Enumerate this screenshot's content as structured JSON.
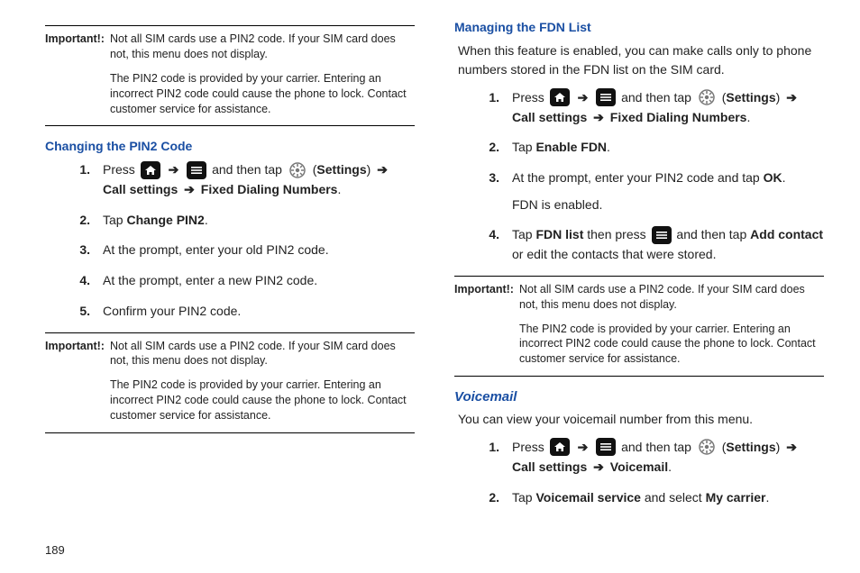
{
  "pageNumber": "189",
  "left": {
    "important1": {
      "label": "Important!:",
      "p1": "Not all SIM cards use a PIN2 code. If your SIM card does not, this menu does not display.",
      "p2": "The PIN2 code is provided by your carrier. Entering an incorrect PIN2 code could cause the phone to lock. Contact customer service for assistance."
    },
    "heading1": "Changing the PIN2 Code",
    "steps1": {
      "s1_a": "Press ",
      "s1_b": " and then tap ",
      "s1_c": " (",
      "s1_settings": "Settings",
      "s1_d": ") ",
      "s1_callsettings": "Call settings",
      "s1_fdn": "Fixed Dialing Numbers",
      "s2_a": "Tap ",
      "s2_b": "Change PIN2",
      "s2_c": ".",
      "s3": "At the prompt, enter your old PIN2 code.",
      "s4": "At the prompt, enter a new PIN2 code.",
      "s5": "Confirm your PIN2 code."
    },
    "important2": {
      "label": "Important!:",
      "p1": "Not all SIM cards use a PIN2 code. If your SIM card does not, this menu does not display.",
      "p2": "The PIN2 code is provided by your carrier. Entering an incorrect PIN2 code could cause the phone to lock. Contact customer service for assistance."
    }
  },
  "right": {
    "heading1": "Managing the FDN List",
    "intro1": "When this feature is enabled, you can make calls only to phone numbers stored in the FDN list on the SIM card.",
    "steps1": {
      "s1_a": "Press ",
      "s1_b": " and then tap ",
      "s1_c": " (",
      "s1_settings": "Settings",
      "s1_d": ") ",
      "s1_callsettings": "Call settings",
      "s1_fdn": "Fixed Dialing Numbers",
      "s2_a": "Tap ",
      "s2_b": "Enable FDN",
      "s2_c": ".",
      "s3_a": "At the prompt, enter your PIN2 code and tap ",
      "s3_ok": "OK",
      "s3_b": ".",
      "s3_c": "FDN is enabled.",
      "s4_a": "Tap ",
      "s4_b": "FDN list",
      "s4_c": " then press ",
      "s4_d": " and then tap ",
      "s4_e": "Add contact",
      "s4_f": " or edit the contacts that were stored."
    },
    "important1": {
      "label": "Important!:",
      "p1": "Not all SIM cards use a PIN2 code. If your SIM card does not, this menu does not display.",
      "p2": "The PIN2 code is provided by your carrier. Entering an incorrect PIN2 code could cause the phone to lock. Contact customer service for assistance."
    },
    "heading2": "Voicemail",
    "intro2": "You can view your voicemail number from this menu.",
    "steps2": {
      "s1_a": "Press ",
      "s1_b": " and then tap ",
      "s1_c": " (",
      "s1_settings": "Settings",
      "s1_d": ") ",
      "s1_callsettings": "Call settings",
      "s1_vm": "Voicemail",
      "s2_a": "Tap ",
      "s2_b": "Voicemail service",
      "s2_c": " and select ",
      "s2_d": "My carrier",
      "s2_e": "."
    }
  }
}
